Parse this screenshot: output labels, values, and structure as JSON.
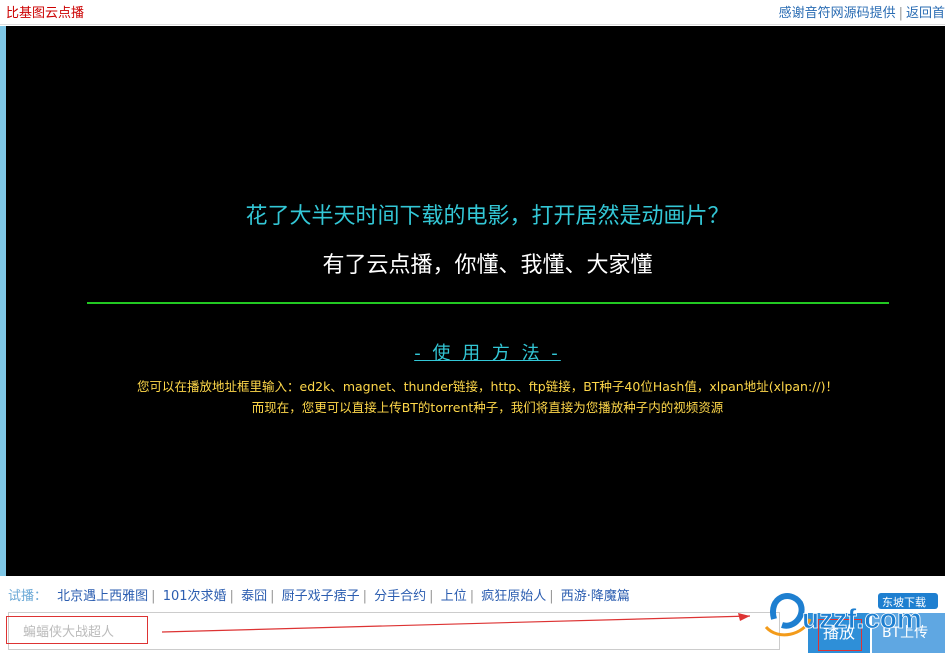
{
  "header": {
    "brand": "比基图云点播",
    "thanks_link": "感谢音符网源码提供",
    "back_link": "返回首"
  },
  "player": {
    "headline": "花了大半天时间下载的电影，打开居然是动画片？",
    "subline": "有了云点播，你懂、我懂、大家懂",
    "howto_title": "- 使 用 方 法 -",
    "desc_line1": "您可以在播放地址框里输入：ed2k、magnet、thunder链接，http、ftp链接，BT种子40位Hash值，xlpan地址(xlpan://)！",
    "desc_line2": "而现在，您更可以直接上传BT的torrent种子，我们将直接为您播放种子内的视频资源"
  },
  "try_bar": {
    "label": "试播：",
    "items": [
      "北京遇上西雅图",
      "101次求婚",
      "泰囧",
      "厨子戏子痞子",
      "分手合约",
      "上位",
      "疯狂原始人",
      "西游·降魔篇"
    ]
  },
  "url_input": {
    "placeholder": "蝙蝠侠大战超人"
  },
  "buttons": {
    "play": "播放",
    "bt_upload": "BT上传"
  },
  "watermark": {
    "text": "uzzf.com",
    "badge": "东坡下载"
  },
  "colors": {
    "headline": "#33c7d6",
    "divider": "#22c822",
    "desc": "#ffd84a",
    "annotation": "#d33333"
  }
}
